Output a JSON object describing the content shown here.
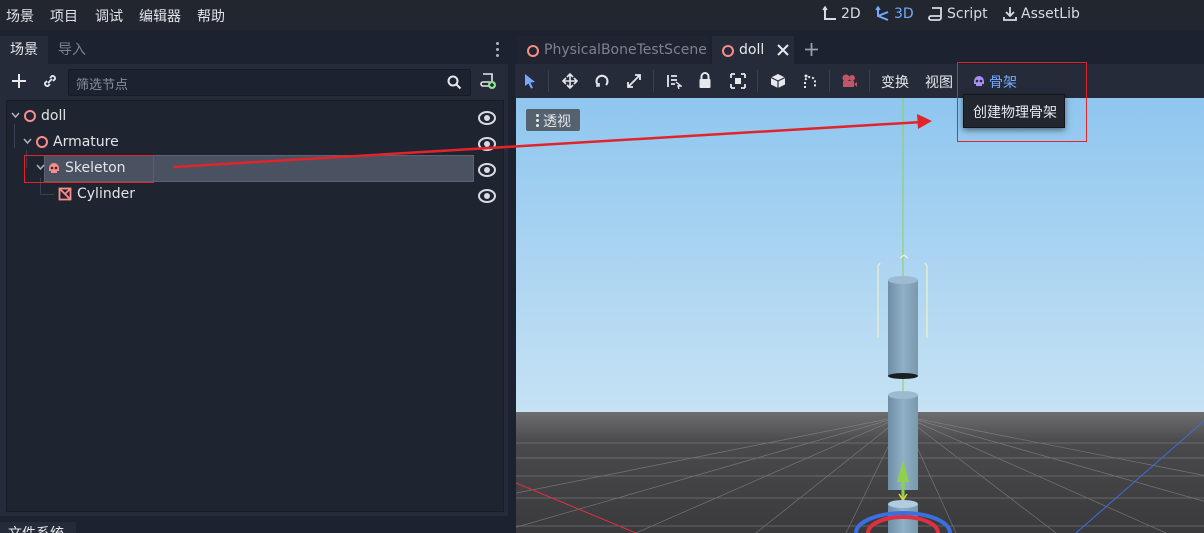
{
  "menubar": {
    "items": [
      "场景",
      "项目",
      "调试",
      "编辑器",
      "帮助"
    ],
    "modes": [
      {
        "label": "2D",
        "icon": "2d-icon",
        "active": false
      },
      {
        "label": "3D",
        "icon": "3d-icon",
        "active": true
      },
      {
        "label": "Script",
        "icon": "script-icon",
        "active": false
      },
      {
        "label": "AssetLib",
        "icon": "assetlib-icon",
        "active": false
      }
    ]
  },
  "scene_dock": {
    "tabs": [
      "场景",
      "导入"
    ],
    "filter_placeholder": "筛选节点",
    "tree": [
      {
        "label": "doll",
        "icon": "node-circle-icon",
        "visible": true
      },
      {
        "label": "Armature",
        "icon": "node-circle-icon",
        "visible": true
      },
      {
        "label": "Skeleton",
        "icon": "skeleton-icon",
        "visible": true,
        "selected": true
      },
      {
        "label": "Cylinder",
        "icon": "mesh-instance-icon",
        "visible": true
      }
    ],
    "bottom_tab": "文件系统"
  },
  "viewport": {
    "tabs": [
      {
        "label": "PhysicalBoneTestScene",
        "active": false
      },
      {
        "label": "doll",
        "active": true
      }
    ],
    "toolbar": {
      "transform_menu": "变换",
      "view_menu": "视图",
      "skeleton_menu": "骨架",
      "skeleton_popup_item": "创建物理骨架"
    },
    "perspective_label": "透视"
  },
  "colors": {
    "accent": "#74a9ff",
    "node": "#fc8b8b",
    "annotation": "#e0242a",
    "sky_top": "#8fc6ef",
    "sky_bottom": "#c6e2f4",
    "ground": "#4a4a4c"
  }
}
